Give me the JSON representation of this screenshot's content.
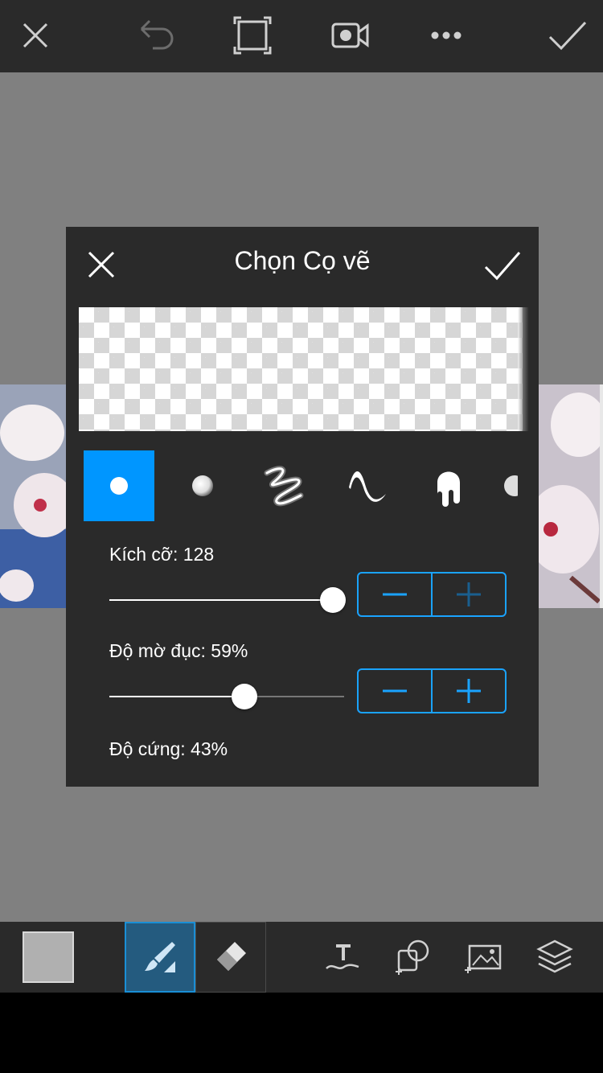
{
  "dialog": {
    "title": "Chọn Cọ vẽ",
    "size_label": "Kích cỡ: 128",
    "opacity_label": "Độ mờ đục: 59%",
    "hardness_label": "Độ cứng: 43%",
    "size_value": 128,
    "size_slider_fraction": 0.95,
    "opacity_value_percent": 59,
    "hardness_value_percent": 43
  },
  "brushes": [
    "round-hard-brush-icon",
    "round-soft-brush-icon",
    "neon-scribble-brush-icon",
    "calligraphy-wave-brush-icon",
    "drip-brush-icon",
    "half-circle-brush-icon"
  ],
  "top_toolbar": [
    "close-icon",
    "undo-icon",
    "crop-icon",
    "video-record-icon",
    "more-icon",
    "confirm-icon"
  ],
  "bottom_toolbar": [
    "color-swatch",
    "brush-tool-icon",
    "eraser-tool-icon",
    "text-icon",
    "sticker-shape-icon",
    "add-photo-icon",
    "layers-icon"
  ],
  "colors": {
    "accent": "#0096ff",
    "stepper_border": "#1aa3ff",
    "toolbar_bg": "#2a2a2a",
    "canvas_bg": "#808080",
    "selected_color": "#b0b0b0"
  }
}
